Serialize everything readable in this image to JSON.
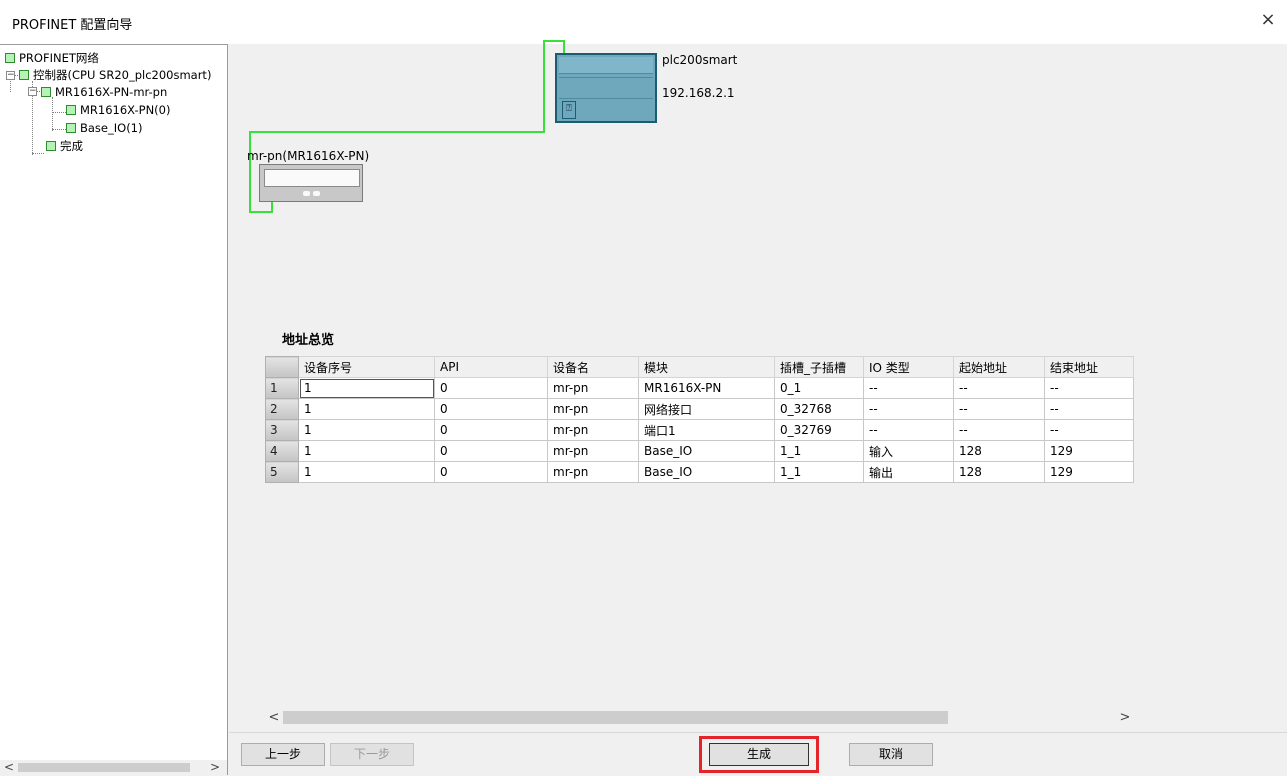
{
  "window": {
    "title": "PROFINET 配置向导",
    "close_glyph": "×"
  },
  "tree": {
    "root": "PROFINET网络",
    "controller": "控制器(CPU SR20_plc200smart)",
    "device": "MR1616X-PN-mr-pn",
    "modules": [
      "MR1616X-PN(0)",
      "Base_IO(1)"
    ],
    "finish": "完成",
    "scroll_left": "<",
    "scroll_right": ">"
  },
  "network": {
    "plc_name": "plc200smart",
    "plc_ip": "192.168.2.1",
    "device_label": "mr-pn(MR1616X-PN)",
    "sd_glyph": "⍰",
    "link_color": "#39e039"
  },
  "overview": {
    "title": "地址总览",
    "columns": [
      "设备序号",
      "API",
      "设备名",
      "模块",
      "插槽_子插槽",
      "IO 类型",
      "起始地址",
      "结束地址"
    ],
    "rows": [
      [
        "1",
        "1",
        "0",
        "mr-pn",
        "MR1616X-PN",
        "0_1",
        "--",
        "--",
        "--"
      ],
      [
        "2",
        "1",
        "0",
        "mr-pn",
        "网络接口",
        "0_32768",
        "--",
        "--",
        "--"
      ],
      [
        "3",
        "1",
        "0",
        "mr-pn",
        "端口1",
        "0_32769",
        "--",
        "--",
        "--"
      ],
      [
        "4",
        "1",
        "0",
        "mr-pn",
        "Base_IO",
        "1_1",
        "输入",
        "128",
        "129"
      ],
      [
        "5",
        "1",
        "0",
        "mr-pn",
        "Base_IO",
        "1_1",
        "输出",
        "128",
        "129"
      ]
    ],
    "scroll_left": "<",
    "scroll_right": ">"
  },
  "buttons": {
    "prev": "上一步",
    "next": "下一步",
    "generate": "生成",
    "cancel": "取消",
    "highlight_color": "#e3242b"
  }
}
